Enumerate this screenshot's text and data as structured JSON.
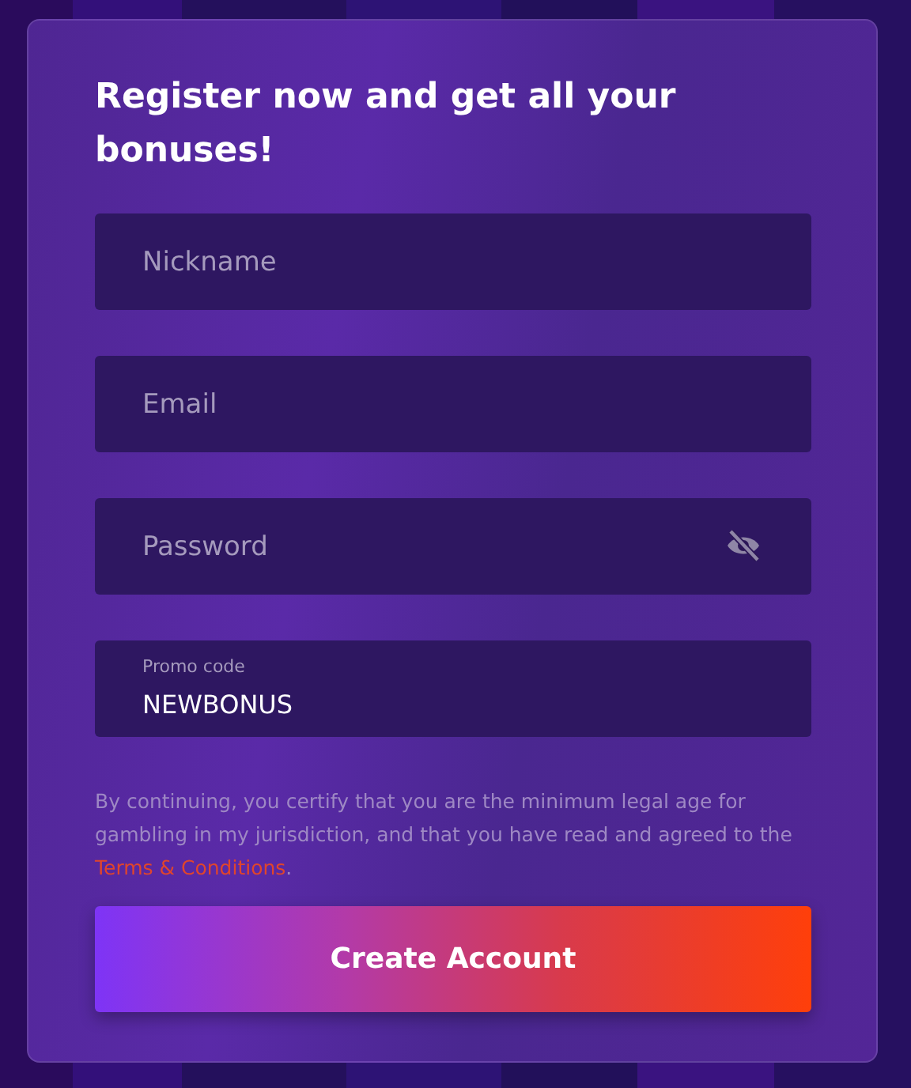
{
  "heading": "Register now and get all your bonuses!",
  "fields": [
    {
      "kind": "text",
      "placeholder": "Nickname"
    },
    {
      "kind": "email",
      "placeholder": "Email"
    },
    {
      "kind": "password",
      "placeholder": "Password"
    },
    {
      "kind": "floating",
      "label": "Promo code",
      "value": "NEWBONUS"
    }
  ],
  "disclaimer": {
    "text": "By continuing, you certify that you are the minimum legal age for gambling in my jurisdiction, and that you have read and agreed to the ",
    "link": "Terms & Conditions",
    "after": "."
  },
  "submit": "Create Account"
}
